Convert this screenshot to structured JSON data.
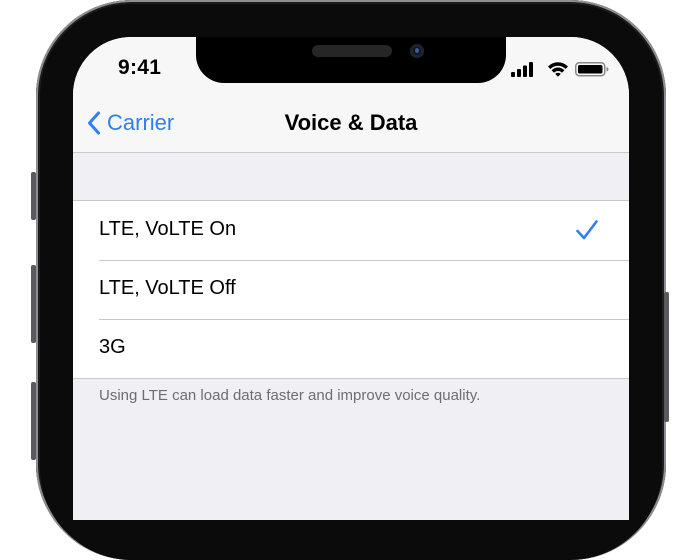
{
  "status_bar": {
    "time": "9:41",
    "icons": [
      "cellular-signal-icon",
      "wifi-icon",
      "battery-icon"
    ]
  },
  "nav": {
    "back_label": "Carrier",
    "title": "Voice & Data"
  },
  "options": [
    {
      "label": "LTE, VoLTE On",
      "selected": true
    },
    {
      "label": "LTE, VoLTE Off",
      "selected": false
    },
    {
      "label": "3G",
      "selected": false
    }
  ],
  "footer": "Using LTE can load data faster and improve voice quality.",
  "colors": {
    "accent": "#2f80ed",
    "background": "#efeff4",
    "separator": "#c8c7cc",
    "secondary_text": "#6d6d72"
  }
}
